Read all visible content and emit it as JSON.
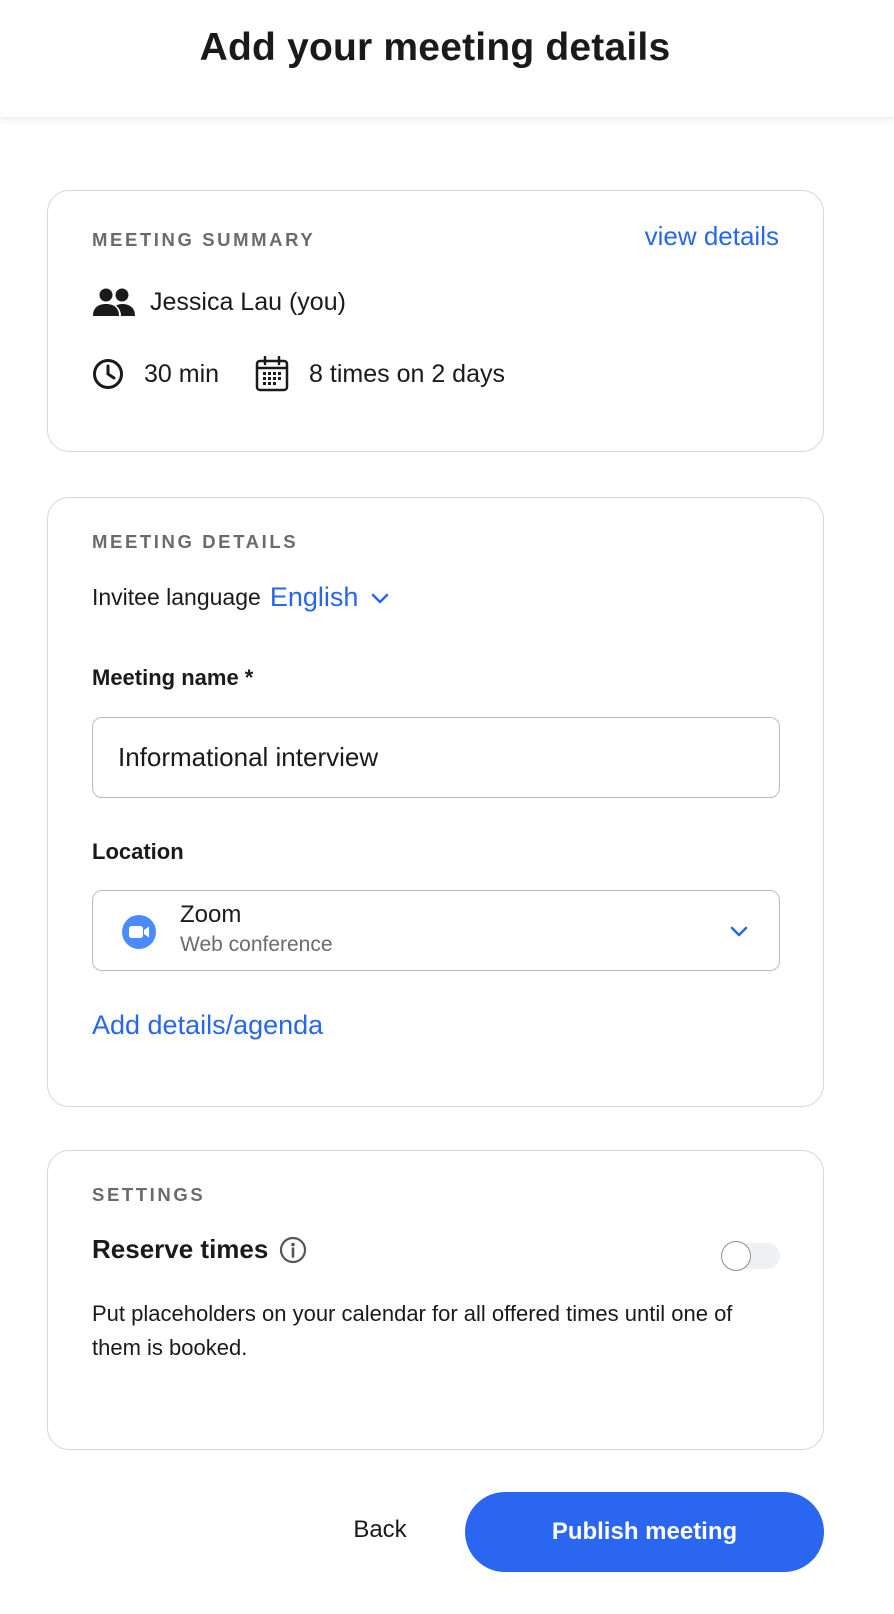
{
  "header": {
    "title": "Add your meeting details"
  },
  "summary": {
    "section_label": "MEETING SUMMARY",
    "view_details_link": "view details",
    "host": "Jessica Lau (you)",
    "duration": "30 min",
    "times": "8 times on 2 days",
    "icons": [
      "people-icon",
      "clock-icon",
      "calendar-icon"
    ]
  },
  "details": {
    "section_label": "MEETING DETAILS",
    "invitee_language_label": "Invitee language",
    "invitee_language_value": "English",
    "meeting_name_label": "Meeting name *",
    "meeting_name_value": "Informational interview",
    "location_label": "Location",
    "location_title": "Zoom",
    "location_subtitle": "Web conference",
    "add_agenda_link": "Add details/agenda"
  },
  "settings": {
    "section_label": "SETTINGS",
    "reserve_times_label": "Reserve times",
    "reserve_times_enabled": false,
    "reserve_times_description": "Put placeholders on your calendar for all offered times until one of them is booked."
  },
  "footer": {
    "back_label": "Back",
    "publish_label": "Publish meeting"
  },
  "colors": {
    "accent": "#2767eb",
    "primary_button": "#2b66f0",
    "zoom_blue": "#4a8cff"
  }
}
